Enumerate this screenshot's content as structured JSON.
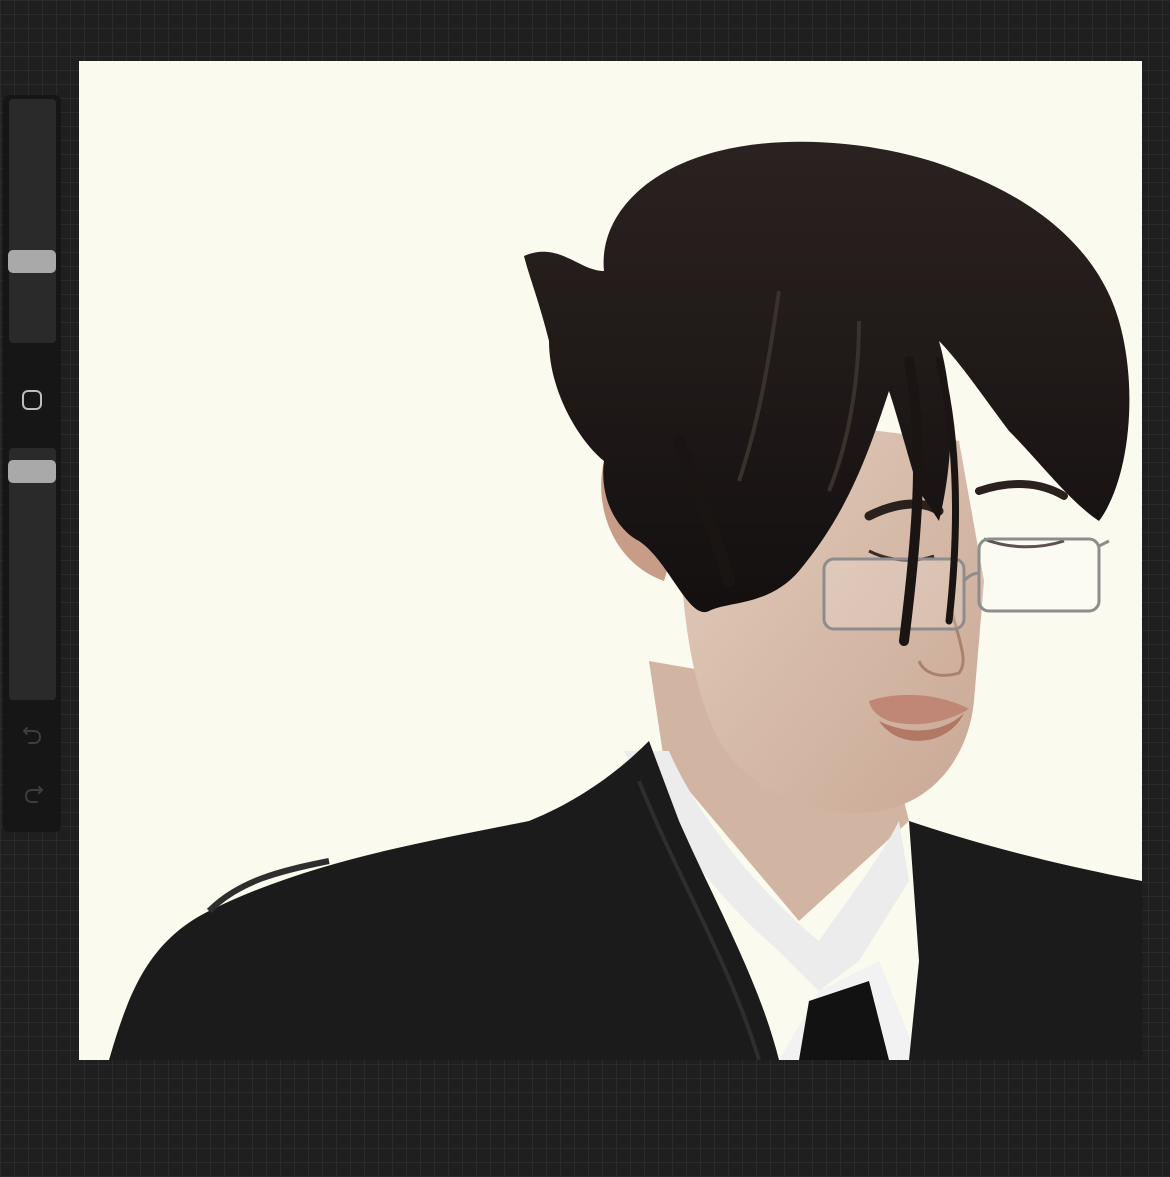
{
  "app": {
    "accent_color": "#1f1f1f",
    "canvas_color": "#fbfaee"
  },
  "sidebar": {
    "brush_size_slider": {
      "level": 0.62
    },
    "modify_button": {
      "icon": "square-icon"
    },
    "opacity_slider": {
      "level": 0.96
    },
    "undo_button": {
      "icon": "undo-arrow-icon"
    },
    "redo_button": {
      "icon": "redo-arrow-icon"
    }
  },
  "canvas": {
    "artwork": "digital-portrait"
  }
}
